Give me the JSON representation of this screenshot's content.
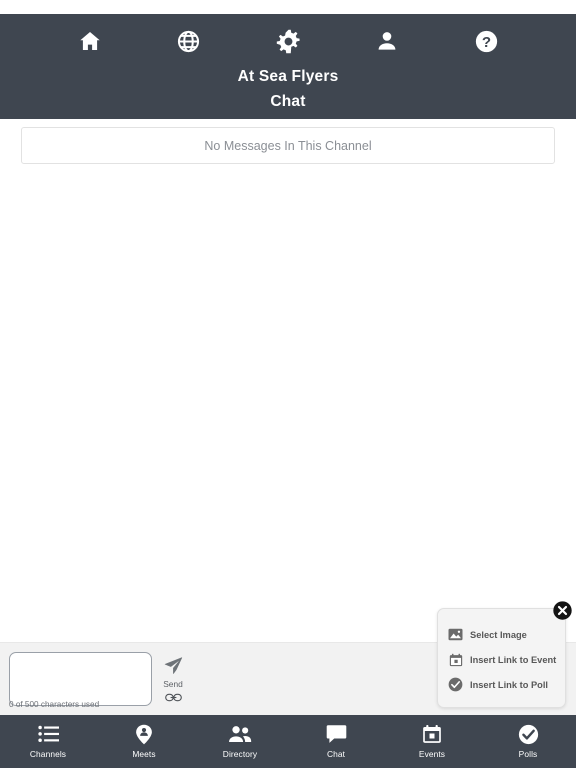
{
  "header": {
    "title": "At Sea Flyers",
    "subtitle": "Chat",
    "icons": [
      {
        "name": "home-icon",
        "label": "Home"
      },
      {
        "name": "globe-icon",
        "label": "Globe"
      },
      {
        "name": "gear-icon",
        "label": "Settings"
      },
      {
        "name": "person-icon",
        "label": "Profile"
      },
      {
        "name": "help-icon",
        "label": "Help"
      }
    ],
    "background_color": "#3f4650"
  },
  "main": {
    "empty_message": "No Messages In This Channel"
  },
  "attachment_popup": {
    "visible": true,
    "close_icon": "close-circle-icon",
    "items": [
      {
        "icon": "image-icon",
        "label": "Select Image"
      },
      {
        "icon": "calendar-icon",
        "label": "Insert Link to Event"
      },
      {
        "icon": "check-circle-icon",
        "label": "Insert Link to Poll"
      }
    ]
  },
  "composer": {
    "input_value": "",
    "input_placeholder": "",
    "send_label": "Send",
    "send_icon": "paper-plane-icon",
    "link_icon": "link-icon",
    "character_counter": "0 of 500 characters used",
    "max_characters": 500,
    "used_characters": 0
  },
  "bottom_nav": {
    "background_color": "#3f4650",
    "items": [
      {
        "icon": "list-icon",
        "label": "Channels"
      },
      {
        "icon": "map-pin-person-icon",
        "label": "Meets"
      },
      {
        "icon": "people-icon",
        "label": "Directory"
      },
      {
        "icon": "chat-bubble-icon",
        "label": "Chat"
      },
      {
        "icon": "calendar-icon",
        "label": "Events"
      },
      {
        "icon": "check-circle-icon",
        "label": "Polls"
      }
    ]
  }
}
